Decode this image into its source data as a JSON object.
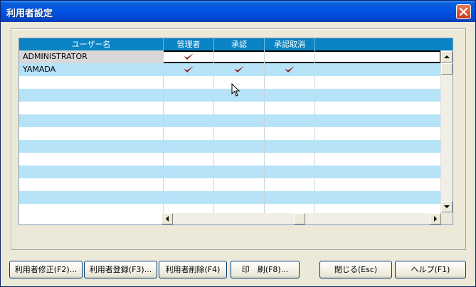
{
  "window": {
    "title": "利用者設定"
  },
  "grid": {
    "columns": [
      "ユーザー名",
      "管理者",
      "承認",
      "承認取消"
    ],
    "rows": [
      {
        "name": "ADMINISTRATOR",
        "admin": true,
        "approve": false,
        "cancel": false
      },
      {
        "name": "YAMADA",
        "admin": true,
        "approve": true,
        "cancel": true
      }
    ],
    "stripe_colors": [
      "#ffffff",
      "#b6e3f8"
    ],
    "header_color": "#0a84c4",
    "check_color": "#8b1a1a"
  },
  "buttons": {
    "edit": "利用者修正(F2)...",
    "register": "利用者登録(F3)...",
    "delete": "利用者削除(F4)",
    "print": "印　刷(F8)...",
    "close": "閉じる(Esc)",
    "help": "ヘルプ(F1)"
  }
}
